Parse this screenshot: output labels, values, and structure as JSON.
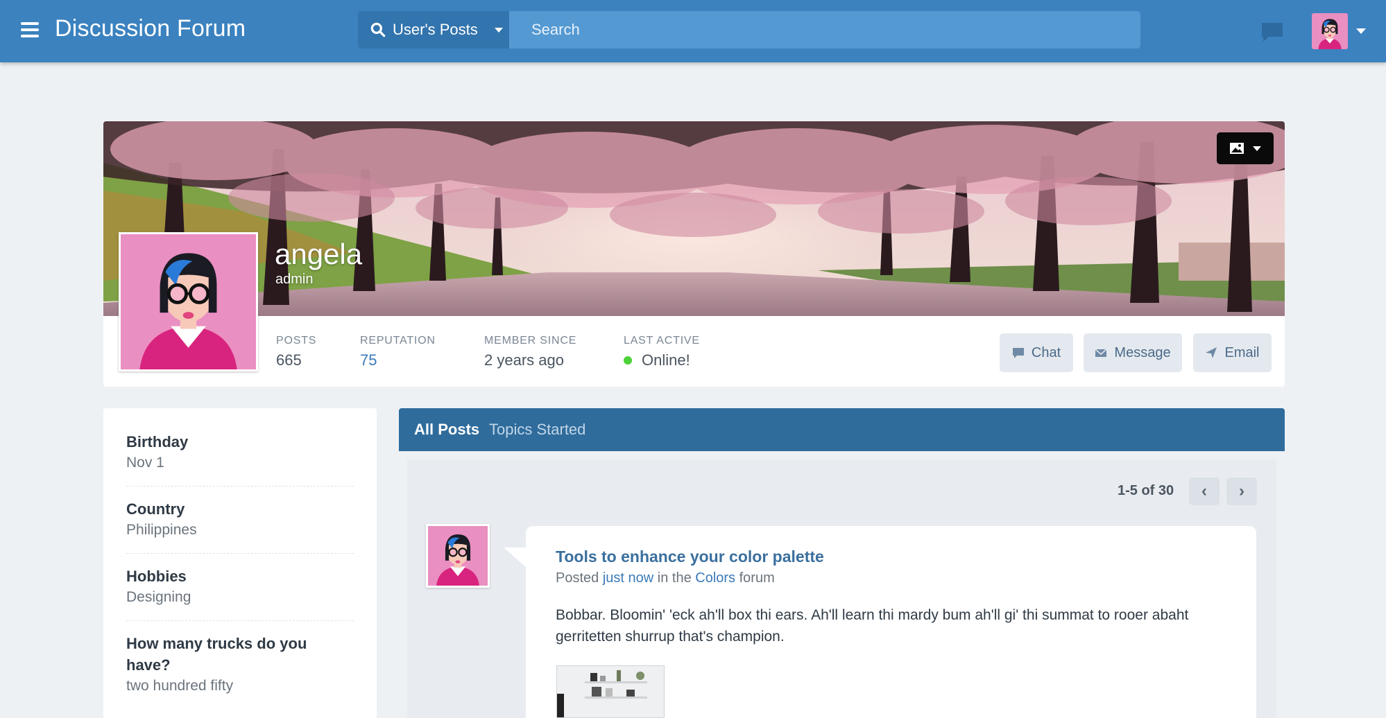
{
  "header": {
    "brand": "Discussion Forum",
    "scope_label": "User's Posts",
    "search_placeholder": "Search"
  },
  "profile": {
    "username": "angela",
    "role": "admin",
    "stats": [
      {
        "label": "POSTS",
        "value": "665"
      },
      {
        "label": "REPUTATION",
        "value": "75"
      },
      {
        "label": "MEMBER SINCE",
        "value": "2 years ago"
      },
      {
        "label": "LAST ACTIVE",
        "value": "Online!"
      }
    ],
    "buttons": {
      "chat": "Chat",
      "message": "Message",
      "email": "Email"
    },
    "online_color": "#4cd137"
  },
  "about": [
    {
      "q": "Birthday",
      "a": "Nov 1"
    },
    {
      "q": "Country",
      "a": "Philippines"
    },
    {
      "q": "Hobbies",
      "a": "Designing"
    },
    {
      "q": "How many trucks do you have?",
      "a": "two hundred fifty"
    }
  ],
  "tabs": {
    "all_posts": "All Posts",
    "topics_started": "Topics Started"
  },
  "pager": {
    "text": "1-5 of 30",
    "prev": "‹",
    "next": "›"
  },
  "post": {
    "title": "Tools to enhance your color palette",
    "meta_posted": "Posted",
    "meta_time": "just now",
    "meta_in": "in the",
    "meta_forum": "Colors",
    "meta_suffix": "forum",
    "body": "Bobbar. Bloomin' 'eck ah'll box thi ears. Ah'll learn thi mardy bum ah'll gi' thi summat to rooer abaht gerritetten shurrup that's champion."
  },
  "colors": {
    "accent": "#3b82bf",
    "tab_bar": "#2f6c9c",
    "link": "#3a7ab8"
  }
}
